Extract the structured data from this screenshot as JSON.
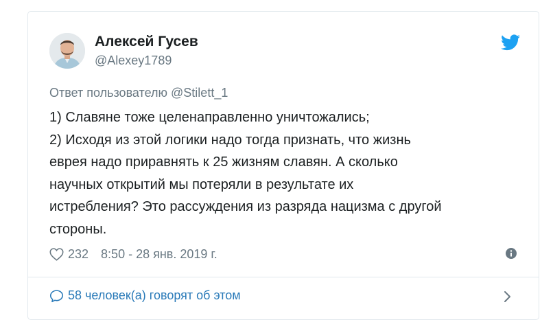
{
  "author": {
    "name": "Алексей Гусев",
    "handle": "@Alexey1789"
  },
  "reply_to": {
    "prefix": "Ответ пользователю",
    "user": "@Stilett_1"
  },
  "tweet_lines": [
    "1) Славяне тоже целенаправленно уничтожались;",
    "2) Исходя из этой логики надо тогда признать, что жизнь",
    "еврея надо приравнять к 25 жизням славян. А сколько",
    "научных открытий мы потеряли в результате их",
    "истребления? Это рассуждения из разряда нацизма с другой",
    "стороны."
  ],
  "stats": {
    "likes": "232",
    "timestamp": "8:50 - 28 янв. 2019 г."
  },
  "footer": {
    "conversation": "58 человек(а) говорят об этом"
  },
  "icons": {
    "brand": "twitter-bird-icon",
    "like": "heart-icon",
    "info": "info-icon",
    "conversation": "speech-bubble-icon",
    "more": "chevron-right-icon"
  },
  "colors": {
    "brand": "#1da1f2",
    "link": "#2b7bb9",
    "secondary_text": "#697882",
    "primary_text": "#1c2022",
    "border": "#e1e8ed"
  }
}
